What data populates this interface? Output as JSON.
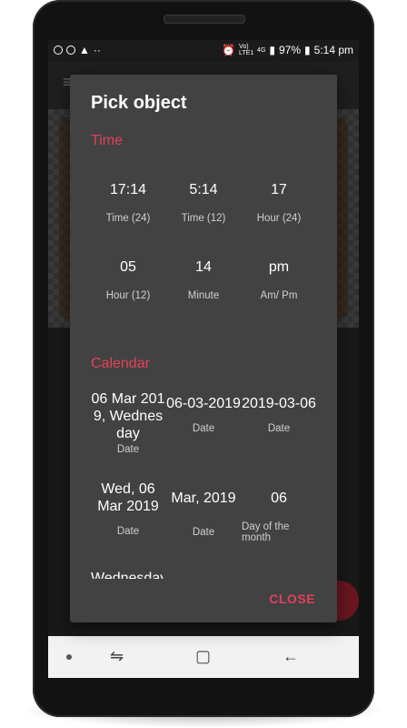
{
  "status_bar": {
    "battery": "97%",
    "time": "5:14 pm",
    "network": "4G",
    "volte": "Vo) LTE1"
  },
  "dialog": {
    "title": "Pick object",
    "sections": {
      "time": "Time",
      "calendar": "Calendar"
    },
    "time_items": [
      {
        "value": "17:14",
        "label": "Time (24)"
      },
      {
        "value": "5:14",
        "label": "Time (12)"
      },
      {
        "value": "17",
        "label": "Hour (24)"
      },
      {
        "value": "05",
        "label": "Hour (12)"
      },
      {
        "value": "14",
        "label": "Minute"
      },
      {
        "value": "pm",
        "label": "Am/ Pm"
      }
    ],
    "calendar_items": [
      {
        "value": "06 Mar 2019, Wednesday",
        "label": "Date"
      },
      {
        "value": "06-03-2019",
        "label": "Date"
      },
      {
        "value": "2019-03-06",
        "label": "Date"
      },
      {
        "value": "Wed, 06 Mar 2019",
        "label": "Date"
      },
      {
        "value": "Mar, 2019",
        "label": "Date"
      },
      {
        "value": "06",
        "label": "Day of the month"
      }
    ],
    "truncated_next": "Wednesday",
    "close_label": "CLOSE"
  },
  "colors": {
    "accent": "#e2405a",
    "dialog_bg": "#424242"
  }
}
